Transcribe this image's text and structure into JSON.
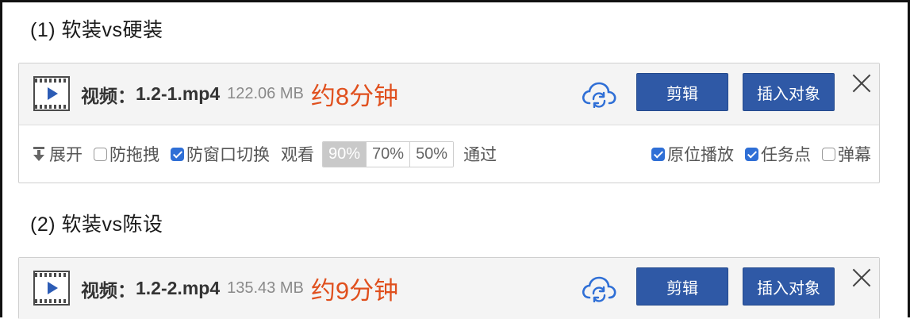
{
  "sections": [
    {
      "heading": "(1) 软装vs硬装",
      "video": {
        "label": "视频：",
        "file_name": "1.2-1.mp4",
        "size": "122.06 MB",
        "duration": "约8分钟"
      }
    },
    {
      "heading": "(2) 软装vs陈设",
      "video": {
        "label": "视频：",
        "file_name": "1.2-2.mp4",
        "size": "135.43 MB",
        "duration": "约9分钟"
      }
    }
  ],
  "buttons": {
    "edit": "剪辑",
    "insert": "插入对象"
  },
  "options": {
    "expand": "展开",
    "anti_drag": {
      "label": "防拖拽",
      "checked": false
    },
    "anti_switch": {
      "label": "防窗口切换",
      "checked": true
    },
    "watch_label": "观看",
    "watch_percent": {
      "options": [
        "90%",
        "70%",
        "50%"
      ],
      "selected": "90%"
    },
    "pass_label": "通过",
    "in_place_play": {
      "label": "原位播放",
      "checked": true
    },
    "task_point": {
      "label": "任务点",
      "checked": true
    },
    "danmaku": {
      "label": "弹幕",
      "checked": false
    }
  },
  "icons": {
    "video_thumb": "video-file-icon",
    "cloud": "cloud-sync-icon",
    "close": "close-icon",
    "expand": "expand-down-icon"
  },
  "colors": {
    "accent_button": "#2f59a6",
    "duration_text": "#e0501e",
    "checkbox_checked": "#2f6fd6",
    "cloud_icon": "#2f6fd6"
  }
}
